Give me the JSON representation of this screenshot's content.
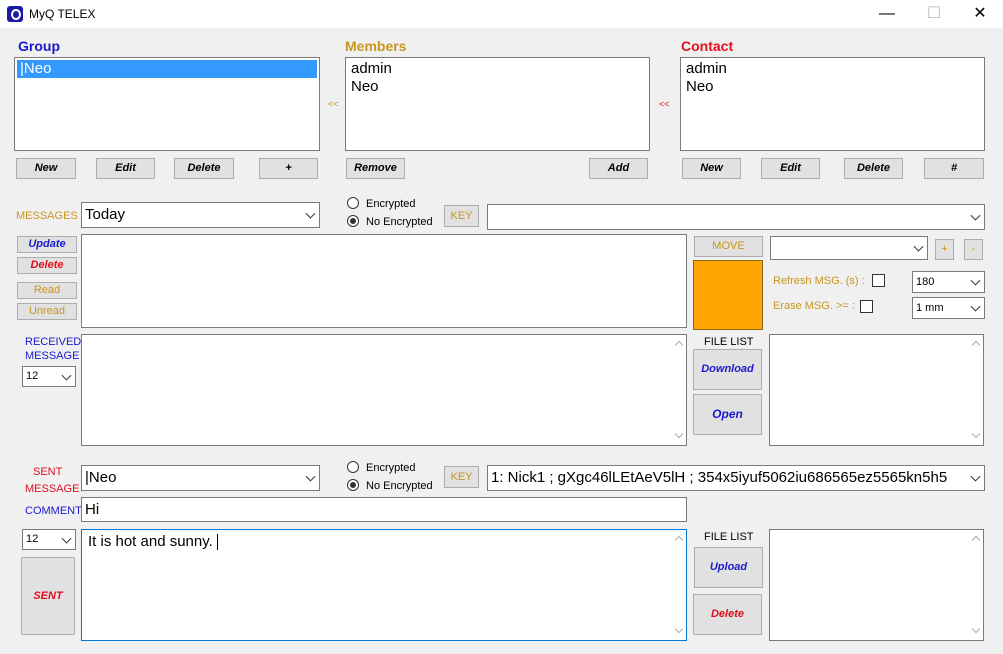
{
  "window": {
    "title": "MyQ TELEX",
    "minimize": "—",
    "maximize": "☐",
    "close": "✕"
  },
  "group": {
    "title": "Group",
    "items": [
      "|Neo"
    ],
    "buttons": {
      "new": "New",
      "edit": "Edit",
      "delete": "Delete",
      "plus": "+"
    }
  },
  "members": {
    "title": "Members",
    "arrow": "<<",
    "items": [
      "admin",
      "Neo"
    ],
    "buttons": {
      "remove": "Remove",
      "add": "Add"
    }
  },
  "contact": {
    "title": "Contact",
    "arrow": "<<",
    "items": [
      "admin",
      "Neo"
    ],
    "buttons": {
      "new": "New",
      "edit": "Edit",
      "delete": "Delete",
      "hash": "#"
    }
  },
  "messages": {
    "label": "MESSAGES",
    "period": "Today",
    "encrypted_label": "Encrypted",
    "no_encrypted_label": "No Encrypted",
    "key_label": "KEY",
    "key_value": "",
    "buttons": {
      "update": "Update",
      "delete": "Delete",
      "read": "Read",
      "unread": "Unread"
    },
    "move_label": "MOVE",
    "move_target": "",
    "plus": "+",
    "minus": "-",
    "refresh_label": "Refresh MSG. (s) :",
    "refresh_value": "180",
    "erase_label": "Erase MSG. >= :",
    "erase_value": "1 mm",
    "color_swatch": "#ffa500"
  },
  "received": {
    "label_line1": "RECEIVED",
    "label_line2": "MESSAGE",
    "font_size": "12",
    "file_list_label": "FILE LIST",
    "download": "Download",
    "open": "Open"
  },
  "sent": {
    "label_line1": "SENT",
    "label_line2": "MESSAGE",
    "recipient": "|Neo",
    "encrypted_label": "Encrypted",
    "no_encrypted_label": "No Encrypted",
    "key_label": "KEY",
    "key_value": "1: Nick1 ; gXgc46lLEtAeV5lH ; 354x5iyuf5062iu686565ez5565kn5h5",
    "comment_label": "COMMENT",
    "comment_value": "Hi",
    "font_size": "12",
    "body": "It is hot and sunny.",
    "send_button": "SENT",
    "file_list_label": "FILE LIST",
    "upload": "Upload",
    "delete": "Delete"
  },
  "colors": {
    "blue": "#1a1acc",
    "gold": "#c8961e",
    "red": "#e0101e"
  }
}
